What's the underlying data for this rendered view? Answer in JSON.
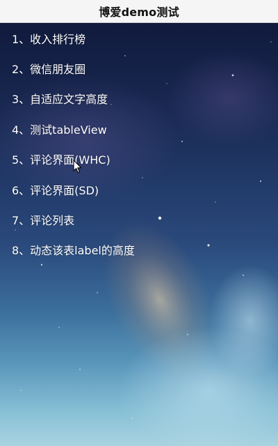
{
  "navbar": {
    "title": "博爱demo测试"
  },
  "menu": {
    "items": [
      {
        "label": "1、收入排行榜"
      },
      {
        "label": "2、微信朋友圈"
      },
      {
        "label": "3、自适应文字高度"
      },
      {
        "label": "4、测试tableView"
      },
      {
        "label": "5、评论界面(WHC)"
      },
      {
        "label": "6、评论界面(SD)"
      },
      {
        "label": "7、评论列表"
      },
      {
        "label": "8、动态该表label的高度"
      }
    ]
  },
  "background": {
    "description_colors": [
      "#0d1738",
      "#2a4a7c",
      "#5b98bc",
      "#a9d3e0"
    ]
  },
  "cursor": {
    "icon": "arrow-cursor-icon"
  }
}
